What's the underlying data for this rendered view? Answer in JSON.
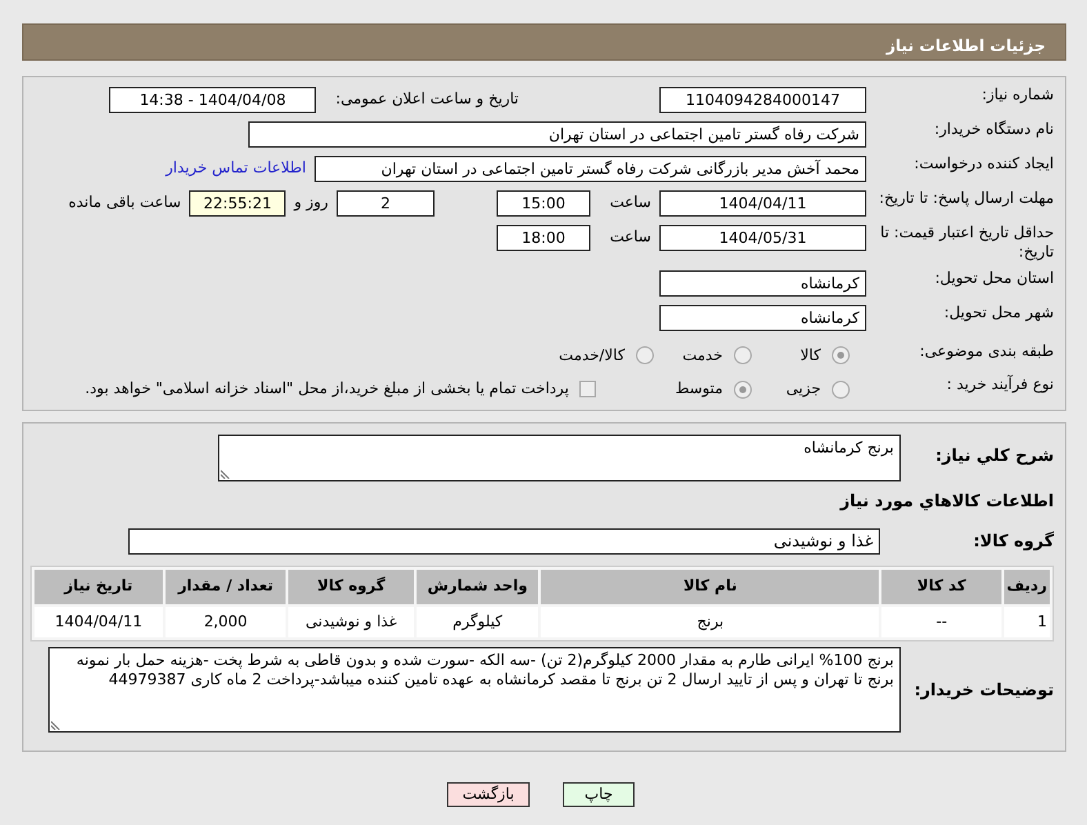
{
  "header": {
    "title": "جزئیات اطلاعات نیاز"
  },
  "need_number": {
    "label": "شماره نیاز:",
    "value": "1104094284000147"
  },
  "announce": {
    "label": "تاریخ و ساعت اعلان عمومی:",
    "value": "1404/04/08 - 14:38"
  },
  "buyer": {
    "label": "نام دستگاه خریدار:",
    "value": "شرکت رفاه گستر تامین اجتماعی در استان تهران"
  },
  "creator": {
    "label": "ایجاد کننده درخواست:",
    "value": "محمد آخش مدیر بازرگانی شرکت رفاه گستر تامین اجتماعی در استان تهران",
    "link": "اطلاعات تماس خریدار"
  },
  "deadline": {
    "label": "مهلت ارسال پاسخ: تا تاریخ:",
    "date": "1404/04/11",
    "time_label": "ساعت",
    "time": "15:00",
    "days": "2",
    "days_label": "روز و",
    "remaining": "22:55:21",
    "remaining_label": "ساعت باقی مانده"
  },
  "validity": {
    "label": "حداقل تاریخ اعتبار قیمت: تا تاریخ:",
    "date": "1404/05/31",
    "time_label": "ساعت",
    "time": "18:00"
  },
  "province": {
    "label": "استان محل تحویل:",
    "value": "کرمانشاه"
  },
  "city": {
    "label": "شهر محل تحویل:",
    "value": "کرمانشاه"
  },
  "category": {
    "label": "طبقه بندی موضوعی:",
    "options": [
      {
        "label": "کالا",
        "selected": true
      },
      {
        "label": "خدمت",
        "selected": false
      },
      {
        "label": "کالا/خدمت",
        "selected": false
      }
    ]
  },
  "process": {
    "label": "نوع فرآیند خرید :",
    "options": [
      {
        "label": "جزیی",
        "selected": false
      },
      {
        "label": "متوسط",
        "selected": true
      }
    ],
    "payment": {
      "label": "پرداخت تمام یا بخشی از مبلغ خرید،از محل \"اسناد خزانه اسلامی\" خواهد بود.",
      "checked": false
    }
  },
  "description": {
    "label": "شرح کلي نياز:",
    "value": "برنج کرمانشاه"
  },
  "goods_title": "اطلاعات کالاهاي مورد نياز",
  "goods_group": {
    "label": "گروه کالا:",
    "value": "غذا و نوشیدنی"
  },
  "table": {
    "columns": [
      "ردیف",
      "کد کالا",
      "نام کالا",
      "واحد شمارش",
      "گروه کالا",
      "تعداد / مقدار",
      "تاریخ نیاز"
    ],
    "rows": [
      [
        "1",
        "--",
        "برنج",
        "کیلوگرم",
        "غذا و نوشیدنی",
        "2,000",
        "1404/04/11"
      ]
    ]
  },
  "notes": {
    "label": "توضیحات خریدار:",
    "value": "برنج 100% ایرانی طارم به مقدار 2000 کیلوگرم(2 تن) -سه الکه -سورت شده و بدون قاطی به شرط پخت -هزینه حمل بار نمونه برنج تا تهران و پس از تایید ارسال 2 تن برنج تا مقصد کرمانشاه به عهده تامین کننده میباشد-پرداخت 2 ماه کاری 44979387"
  },
  "buttons": [
    {
      "label": "چاپ",
      "kind": "print"
    },
    {
      "label": "بازگشت",
      "kind": "back"
    }
  ]
}
